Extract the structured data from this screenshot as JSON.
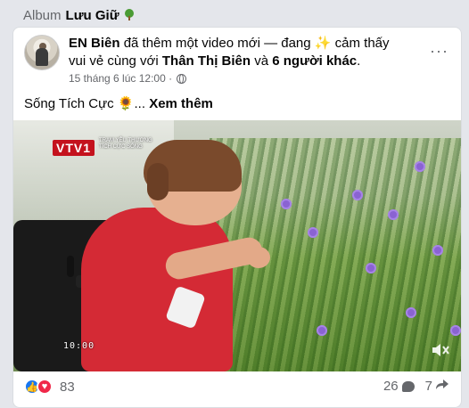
{
  "album": {
    "prefix": "Album",
    "name": "Lưu Giữ",
    "icon": "tree-icon"
  },
  "post": {
    "author": "EN Biên",
    "action_text": "đã thêm một video mới — đang",
    "feeling_icon": "sparkle-icon",
    "feeling_text": "cảm thấy vui vẻ cùng với",
    "tagged_person": "Thân Thị Biên",
    "and_text": "và",
    "others": "6 người khác",
    "end_punct": ".",
    "timestamp": "15 tháng 6 lúc 12:00 ·",
    "privacy_icon": "globe-icon",
    "more_icon": "more-options-icon",
    "more_glyph": "···"
  },
  "caption": {
    "text": "Sống Tích Cực",
    "emoji_icon": "sunflower-icon",
    "ellipsis": "...",
    "see_more": "Xem thêm"
  },
  "video": {
    "logo": "VTV1",
    "logo_sub": "TRẠM YÊU THƯƠNG TÍCH CỰC SỐNG",
    "time": "10:00",
    "mute_icon": "mute-icon"
  },
  "footer": {
    "reaction_count": "83",
    "comment_count": "26",
    "share_count": "7",
    "like_icon": "like-icon",
    "love_icon": "love-icon",
    "comment_icon": "comment-icon",
    "share_icon": "share-icon"
  },
  "colors": {
    "accent": "#1877f2",
    "love": "#f02849",
    "muted": "#65676b",
    "shirt": "#d42a35"
  }
}
